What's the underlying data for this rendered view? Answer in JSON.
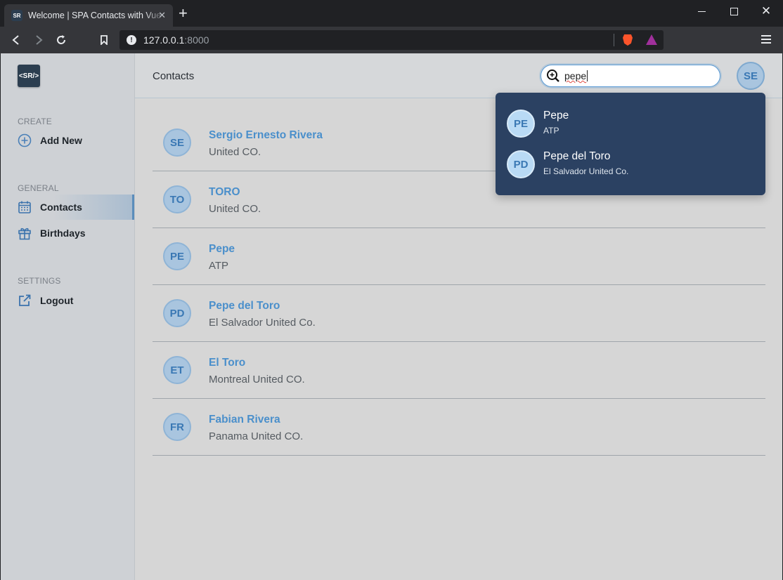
{
  "browser": {
    "tab_title": "Welcome | SPA Contacts with Vue",
    "tab_favicon_text": "SR",
    "url_host": "127.0.0.1",
    "url_port": ":8000"
  },
  "app": {
    "logo_text": "<SR/>",
    "header_title": "Contacts",
    "user_initials": "SE",
    "accent_color": "#4a8fcb"
  },
  "sidebar": {
    "sections": [
      {
        "label": "CREATE"
      },
      {
        "label": "GENERAL"
      },
      {
        "label": "SETTINGS"
      }
    ],
    "items": [
      {
        "label": "Add New",
        "icon": "plus-circle-icon"
      },
      {
        "label": "Contacts",
        "icon": "calendar-icon",
        "active": true
      },
      {
        "label": "Birthdays",
        "icon": "gift-icon"
      },
      {
        "label": "Logout",
        "icon": "external-link-icon"
      }
    ]
  },
  "search": {
    "value": "pepe",
    "results": [
      {
        "initials": "PE",
        "name": "Pepe",
        "company": "ATP"
      },
      {
        "initials": "PD",
        "name": "Pepe del Toro",
        "company": "El Salvador United Co."
      }
    ]
  },
  "contacts": [
    {
      "initials": "SE",
      "name": "Sergio Ernesto Rivera",
      "company": "United CO."
    },
    {
      "initials": "TO",
      "name": "TORO",
      "company": "United CO."
    },
    {
      "initials": "PE",
      "name": "Pepe",
      "company": "ATP"
    },
    {
      "initials": "PD",
      "name": "Pepe del Toro",
      "company": "El Salvador United Co."
    },
    {
      "initials": "ET",
      "name": "El Toro",
      "company": "Montreal United CO."
    },
    {
      "initials": "FR",
      "name": "Fabian Rivera",
      "company": "Panama United CO."
    }
  ]
}
